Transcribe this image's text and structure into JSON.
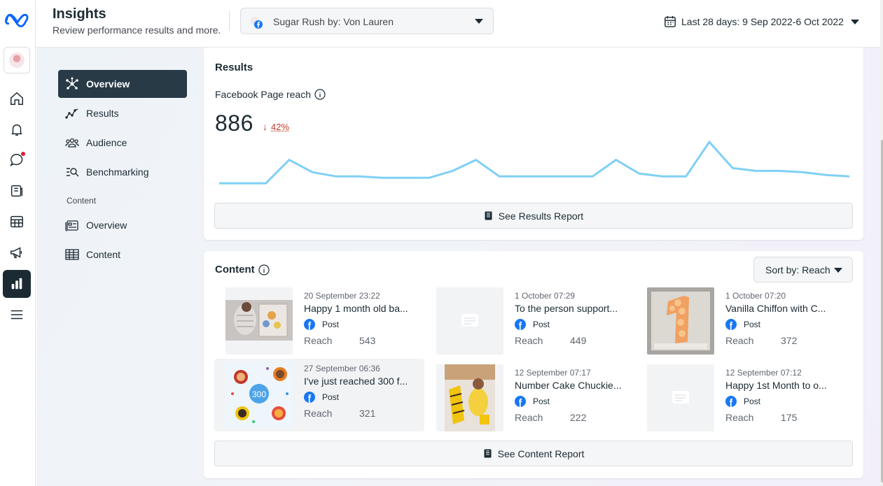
{
  "header": {
    "title": "Insights",
    "subtitle": "Review performance results and more.",
    "page_selector": "Sugar Rush by: Von Lauren",
    "date_range": "Last 28 days: 9 Sep 2022-6 Oct 2022"
  },
  "rail": {
    "icons": [
      "home-icon",
      "bell-icon",
      "chat-icon",
      "pages-icon",
      "table-icon",
      "megaphone-icon",
      "insights-icon",
      "menu-icon"
    ],
    "notification_dot_color": "#e41e3f",
    "active_color": "#1c2b33"
  },
  "subnav": {
    "items": [
      {
        "label": "Overview",
        "icon": "overview-icon",
        "active": true
      },
      {
        "label": "Results",
        "icon": "trend-icon"
      },
      {
        "label": "Audience",
        "icon": "people-icon"
      },
      {
        "label": "Benchmarking",
        "icon": "benchmark-icon"
      }
    ],
    "content_section": "Content",
    "content_items": [
      {
        "label": "Overview",
        "icon": "content-overview-icon"
      },
      {
        "label": "Content",
        "icon": "content-table-icon"
      }
    ]
  },
  "results": {
    "title": "Results",
    "metric_label": "Facebook Page reach",
    "value": "886",
    "change": "42%",
    "change_direction": "down",
    "change_color": "#c13a2a",
    "line_color": "#7fd0f5",
    "series": [
      3,
      3,
      3,
      20,
      11,
      8,
      8,
      7,
      7,
      7,
      12,
      20,
      8,
      8,
      8,
      8,
      8,
      20,
      10,
      8,
      8,
      33,
      14,
      12,
      12,
      11,
      9,
      8
    ],
    "report_button": "See Results Report"
  },
  "content": {
    "title": "Content",
    "sort_label": "Sort by: Reach",
    "report_button": "See Content Report",
    "posts": [
      {
        "date": "20 September 23:22",
        "title": "Happy 1 month old ba...",
        "type": "Post",
        "metric": "Reach",
        "value": "543",
        "thumb": "baby-photo"
      },
      {
        "date": "1 October 07:29",
        "title": "To the person support...",
        "type": "Post",
        "metric": "Reach",
        "value": "449",
        "thumb": "placeholder"
      },
      {
        "date": "1 October 07:20",
        "title": "Vanilla Chiffon with C...",
        "type": "Post",
        "metric": "Reach",
        "value": "372",
        "thumb": "cake-photo"
      },
      {
        "date": "27 September 06:36",
        "title": "I've just reached 300 f...",
        "type": "Post",
        "metric": "Reach",
        "value": "321",
        "thumb": "milestone-300"
      },
      {
        "date": "12 September 07:17",
        "title": "Number Cake Chuckie...",
        "type": "Post",
        "metric": "Reach",
        "value": "222",
        "thumb": "baby-cake-photo"
      },
      {
        "date": "12 September 07:12",
        "title": "Happy 1st Month to o...",
        "type": "Post",
        "metric": "Reach",
        "value": "175",
        "thumb": "placeholder"
      }
    ]
  }
}
